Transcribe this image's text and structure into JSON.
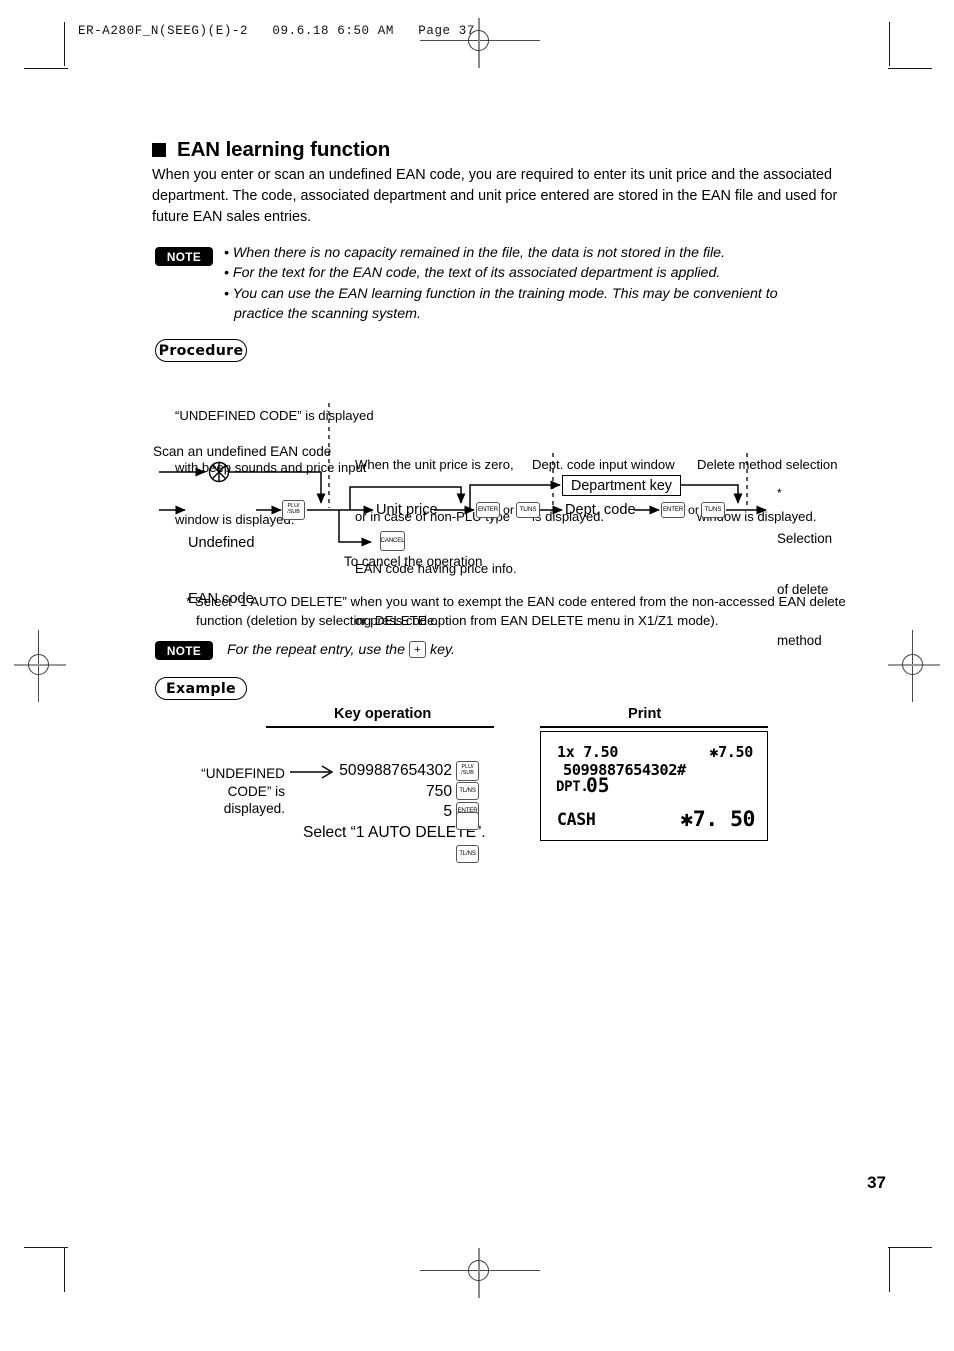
{
  "document": {
    "file_header": "ER-A280F_N(SEEG)(E)-2   09.6.18 6:50 AM   Page 37",
    "page_number": "37"
  },
  "section": {
    "title": "EAN learning function",
    "intro": "When you enter or scan an undefined EAN code, you are required to enter its unit price and the associated department. The code, associated department and unit price entered are stored in the EAN file and used for future EAN sales entries."
  },
  "note_top": {
    "badge": "NOTE",
    "items": [
      "• When there is no capacity remained in the file, the data is not stored in the file.",
      "• For the text for the EAN code, the text of its associated department is applied.",
      "• You can use the EAN learning function in the training mode. This may be convenient to",
      "practice the scanning system."
    ]
  },
  "procedure": {
    "pill_label": "Procedure",
    "callouts": {
      "undefined_code": [
        "“UNDEFINED CODE” is displayed",
        "with beep sounds and price input",
        "window is displayed."
      ],
      "unit_price_zero": [
        "When the unit price is zero,",
        "or in case of non-PLU type",
        "EAN code having price info.",
        "or press code."
      ],
      "dept_window": [
        "Dept. code input window",
        "is displayed."
      ],
      "delete_window": [
        "Delete method selection",
        "window is displayed."
      ]
    },
    "nodes": {
      "scan_label": "Scan an undefined EAN code",
      "scanner_icon": "scanner-icon",
      "undefined_ean_l1": "Undefined",
      "undefined_ean_l2": "EAN code",
      "unit_price": "Unit price",
      "dept_key_box": "Department key",
      "dept_code": "Dept. code",
      "selection_l1": "Selection",
      "selection_l2": "of delete",
      "selection_l3": "method",
      "cancel_caption": "To cancel the operation",
      "or_1": "or",
      "or_2": "or",
      "star": "*"
    },
    "keys": {
      "plu_sub_top": "PLU/",
      "plu_sub_bottom": "/SUB",
      "cancel": "CANCEL",
      "enter": "ENTER",
      "tlns": "TL/NS"
    }
  },
  "footnote": {
    "line1": "* Select “1 AUTO DELETE” when you want to exempt the EAN code entered from the non-accessed EAN delete",
    "line2": "function (deletion by selecting DELETE option from EAN DELETE menu in X1/Z1 mode)."
  },
  "note_repeat": {
    "badge": "NOTE",
    "text_before": "For the repeat entry, use the",
    "key_label": "+",
    "text_after": "key."
  },
  "example": {
    "pill_label": "Example",
    "col_key_operation": "Key operation",
    "col_print": "Print",
    "left_tag_l1": "“UNDEFINED CODE” is",
    "left_tag_l2": "displayed.",
    "operations": [
      {
        "value": "5099887654302",
        "key_top": "PLU/",
        "key_bottom": "/SUB"
      },
      {
        "value": "750",
        "key_top": "TL/NS",
        "key_bottom": ""
      },
      {
        "value": "5",
        "key_top": "ENTER",
        "key_bottom": ""
      }
    ],
    "select_line": "Select “1 AUTO DELETE”.",
    "final_key": "TL/NS"
  },
  "receipt": {
    "qty_price": "1x 7.50",
    "amount_1": "✱7.50",
    "ean_code": "5099887654302#",
    "dept_label": "DPT.",
    "dept_number": "05",
    "cash_label": "CASH",
    "amount_2": "✱7. 50"
  }
}
